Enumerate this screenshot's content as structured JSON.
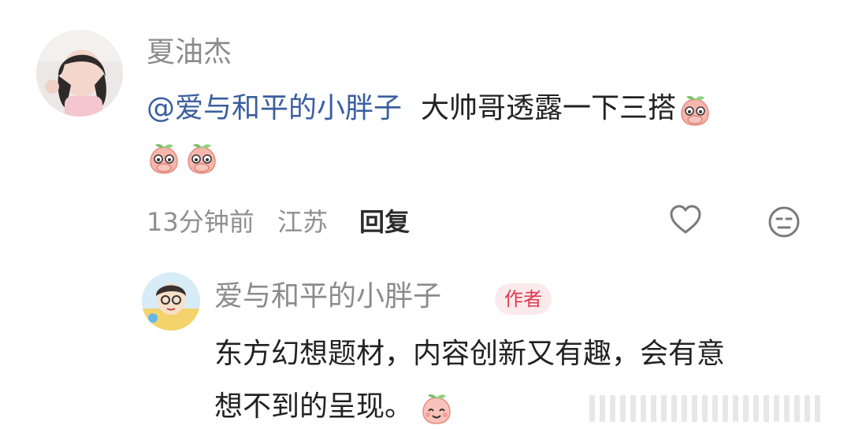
{
  "comment": {
    "author": "夏油杰",
    "mention": "@爱与和平的小胖子",
    "text": "大帅哥透露一下三搭",
    "emoji": "peach-blush-emoji",
    "time": "13分钟前",
    "location": "江苏",
    "reply_label": "回复",
    "icons": [
      "heart-icon",
      "dislike-face-icon"
    ]
  },
  "reply": {
    "author": "爱与和平的小胖子",
    "badge": "作者",
    "line1": "东方幻想题材，内容创新又有趣，会有意",
    "line2": "想不到的呈现。",
    "emoji": "peach-smile-emoji"
  },
  "colors": {
    "name": "#8b8b8b",
    "text": "#222222",
    "badge_bg": "#fbeaec",
    "badge_text": "#e03a4d",
    "meta": "#8f8f8f"
  }
}
